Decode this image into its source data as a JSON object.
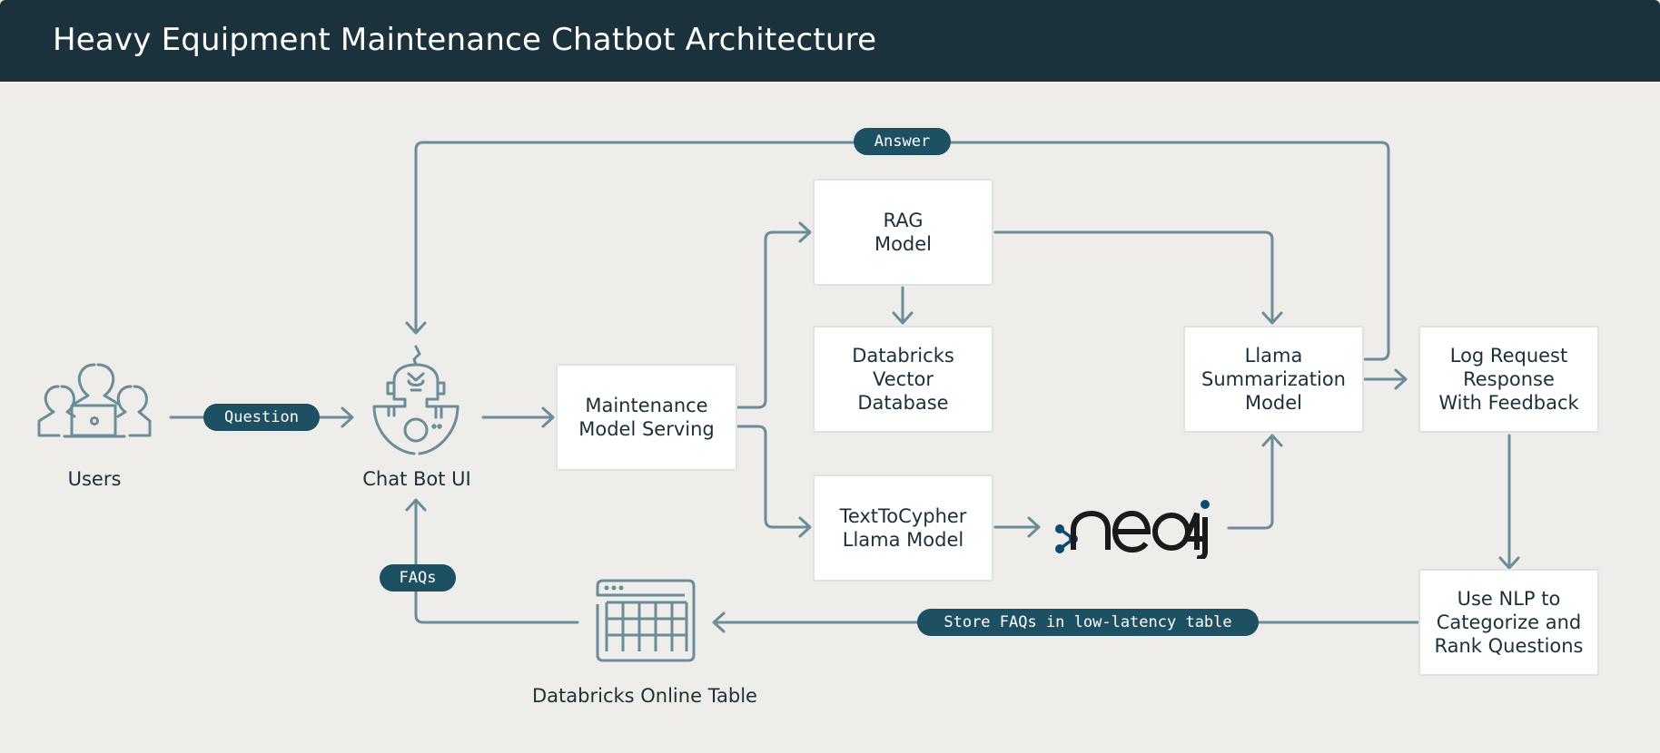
{
  "header": {
    "title": "Heavy Equipment Maintenance Chatbot Architecture"
  },
  "colors": {
    "header_bg": "#1b313b",
    "canvas_bg": "#efede9",
    "wire": "#6a8d99",
    "pill_bg": "#1d5063",
    "neo4j_blue": "#0a4a72"
  },
  "nodes": {
    "users": {
      "label": "Users",
      "icon": "users-laptop-icon"
    },
    "chatbot": {
      "label": "Chat Bot UI",
      "icon": "robot-icon"
    },
    "maintenance": {
      "label": "Maintenance\nModel Serving"
    },
    "rag": {
      "label": "RAG\nModel"
    },
    "vector_db": {
      "label": "Databricks\nVector\nDatabase"
    },
    "text_to_cypher": {
      "label": "TextToCypher\nLlama Model"
    },
    "neo4j": {
      "label": "neo4j",
      "icon": "neo4j-logo-icon"
    },
    "llama_summ": {
      "label": "Llama\nSummarization\nModel"
    },
    "log_request": {
      "label": "Log Request\nResponse\nWith Feedback"
    },
    "nlp": {
      "label": "Use NLP to\nCategorize and\nRank Questions"
    },
    "online_table": {
      "label": "Databricks Online Table",
      "icon": "table-icon"
    }
  },
  "edges": {
    "question": "Question",
    "answer": "Answer",
    "faqs": "FAQs",
    "store_faqs": "Store FAQs in low-latency table"
  }
}
